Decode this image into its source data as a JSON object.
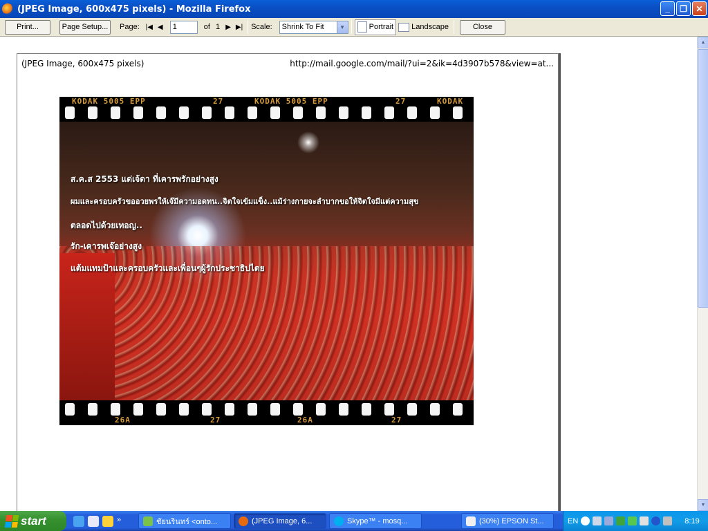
{
  "window": {
    "title": "(JPEG Image, 600x475 pixels) - Mozilla Firefox",
    "min": "_",
    "max": "❐",
    "close": "✕"
  },
  "toolbar": {
    "print": "Print...",
    "page_setup": "Page Setup...",
    "page_label": "Page:",
    "page_value": "1",
    "of_label": "of",
    "page_total": "1",
    "scale_label": "Scale:",
    "scale_value": "Shrink To Fit",
    "portrait": "Portrait",
    "landscape": "Landscape",
    "close": "Close"
  },
  "page": {
    "header_left": "(JPEG Image, 600x475 pixels)",
    "header_right": "http://mail.google.com/mail/?ui=2&ik=4d3907b578&view=at..."
  },
  "photo": {
    "film_top": [
      "KODAK 5005 EPP",
      "27",
      "KODAK 5005 EPP",
      "27",
      "KODAK"
    ],
    "film_bottom": [
      "26A",
      "27",
      "26A",
      "27"
    ],
    "lines": [
      "ส.ค.ส 2553 แด่เจ้ดา ที่เคารพรักอย่างสูง",
      "ผมและครอบครัวขออวยพรให้เจ๊มีความอดทน..จิตใจเข้มแข็ง..แม้ร่างกายจะลำบากขอให้จิตใจมีแต่ความสุข",
      "ตลอดไปด้วยเทอญ..",
      "รัก-เคารพเจ๊อย่างสูง",
      "แต้มแทมป้าและครอบครัวและเพื่อนๆผู้รักประชาธิปไตย"
    ]
  },
  "taskbar": {
    "start": "start",
    "tasks": [
      "ชัยนรินทร์ <onto...",
      "(JPEG Image, 6...",
      "Skype™ - mosq...",
      "(30%) EPSON St..."
    ],
    "lang": "EN",
    "clock": "8:19"
  }
}
